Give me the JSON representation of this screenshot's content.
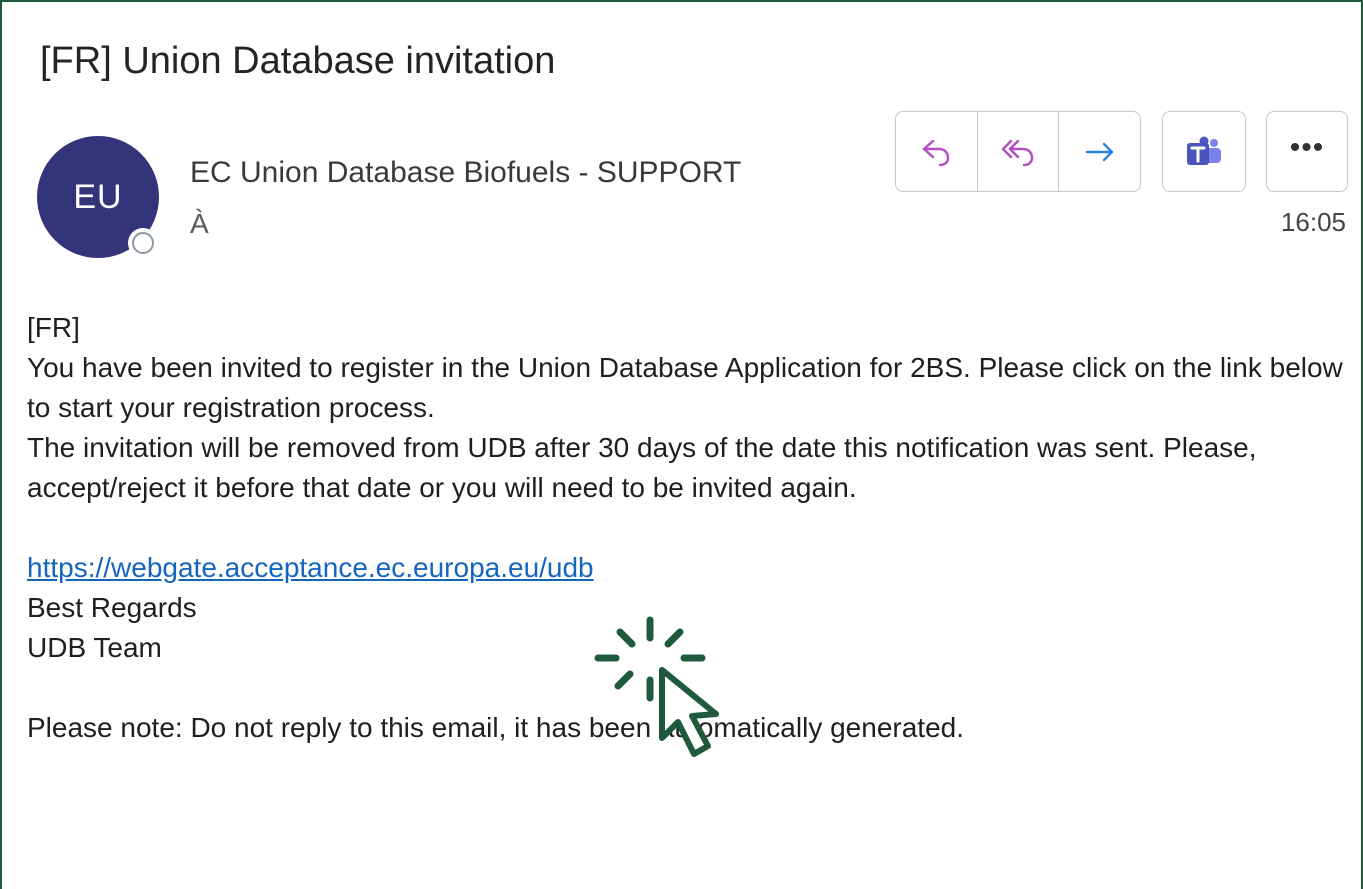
{
  "email": {
    "subject": "[FR] Union Database invitation",
    "avatar_initials": "EU",
    "sender": "EC Union Database Biofuels - SUPPORT",
    "to_label": "À",
    "time": "16:05"
  },
  "toolbar": {
    "reply": "reply-icon",
    "reply_all": "reply-all-icon",
    "forward": "forward-icon",
    "teams": "teams-icon",
    "more": "•••"
  },
  "body": {
    "lang_tag": "[FR]",
    "para1": "You have been invited to register in the Union Database Application for 2BS. Please click on the link below to start your registration process.",
    "para2": "The invitation will be removed from UDB after 30 days of the date this notification was sent. Please, accept/reject it before that date or you will need to be invited again.",
    "link": "https://webgate.acceptance.ec.europa.eu/udb",
    "regards": "Best Regards",
    "team": "UDB Team",
    "note": "Please note: Do not reply to this email, it has been automatically generated."
  },
  "colors": {
    "frame": "#1f5a3c",
    "avatar": "#33347a",
    "reply": "#b44cc4",
    "forward": "#2b86d9",
    "teams": "#4b53bc",
    "link": "#1565c0",
    "cursor": "#1f5a3c"
  }
}
